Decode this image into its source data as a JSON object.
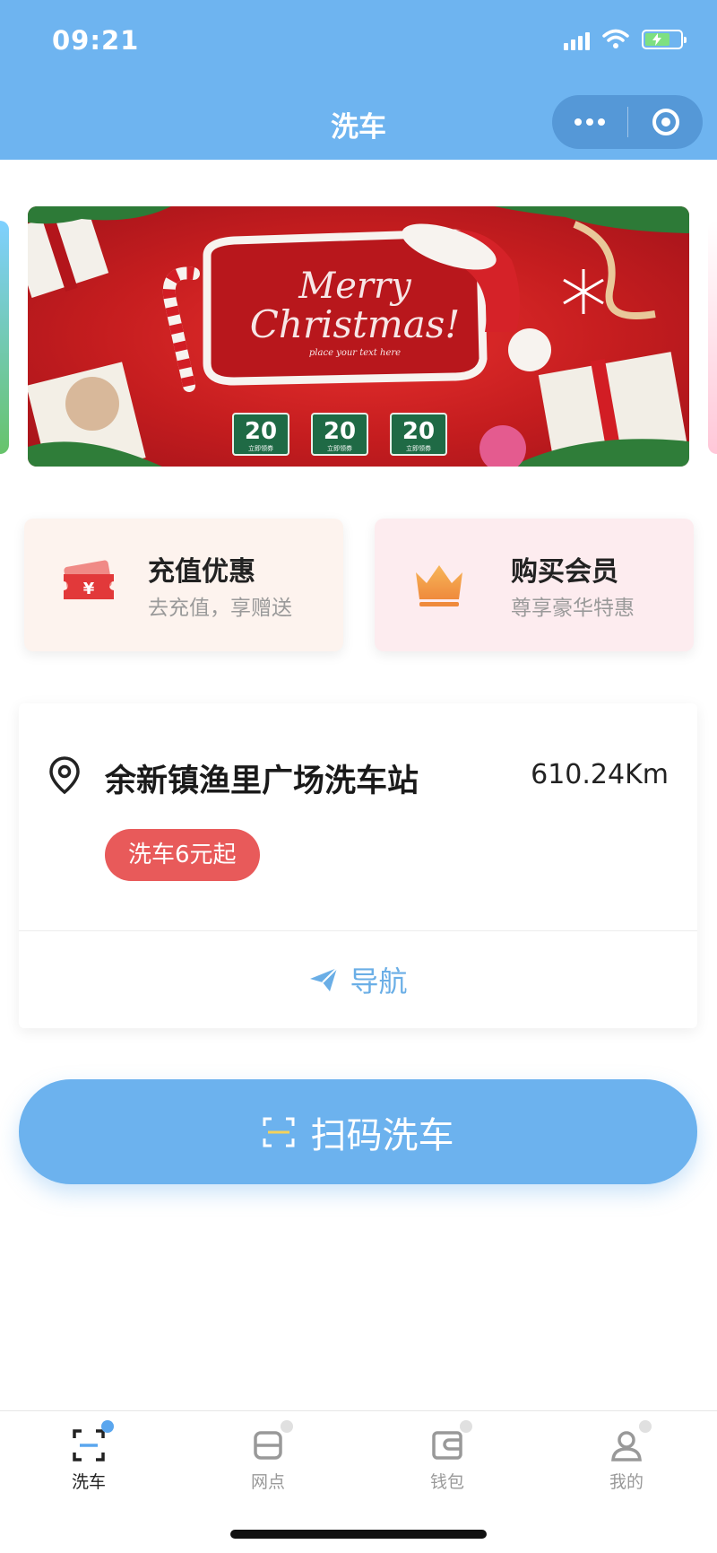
{
  "status_bar": {
    "time": "09:21"
  },
  "header": {
    "title": "洗车"
  },
  "banner": {
    "line1": "Merry",
    "line2": "Christmas!",
    "line3": "place your text here",
    "coupons": [
      "20",
      "20",
      "20"
    ],
    "coupon_sub": "立即领券"
  },
  "features": [
    {
      "title": "充值优惠",
      "subtitle": "去充值，享赠送",
      "icon": "ticket-icon"
    },
    {
      "title": "购买会员",
      "subtitle": "尊享豪华特惠",
      "icon": "crown-icon"
    }
  ],
  "station": {
    "name": "余新镇渔里广场洗车站",
    "distance": "610.24Km",
    "price_tag": "洗车6元起",
    "nav_label": "导航"
  },
  "scan_button": {
    "label": "扫码洗车"
  },
  "tabs": [
    {
      "label": "洗车",
      "icon": "scan-icon",
      "active": true
    },
    {
      "label": "网点",
      "icon": "store-icon",
      "active": false
    },
    {
      "label": "钱包",
      "icon": "wallet-icon",
      "active": false
    },
    {
      "label": "我的",
      "icon": "user-icon",
      "active": false
    }
  ],
  "colors": {
    "header": "#6eb4f0",
    "accent": "#6cb2ee",
    "price_tag": "#e85a5a",
    "banner_red": "#c51d1f"
  }
}
